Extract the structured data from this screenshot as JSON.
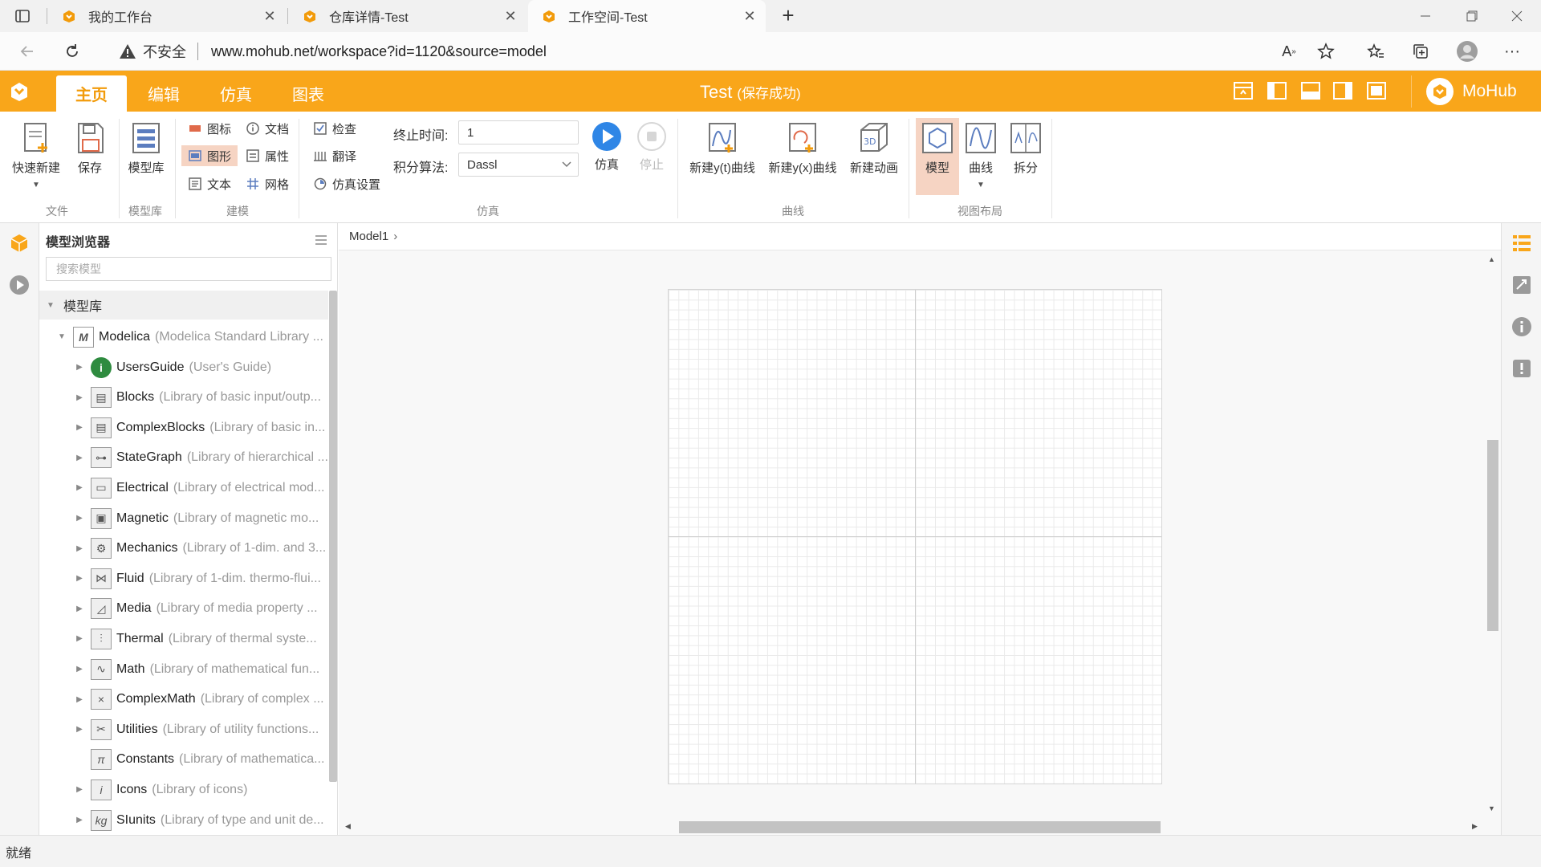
{
  "browser": {
    "tabs": [
      {
        "title": "我的工作台",
        "active": false
      },
      {
        "title": "仓库详情-Test",
        "active": false
      },
      {
        "title": "工作空间-Test",
        "active": true
      }
    ],
    "new_tab": "+",
    "url_warning": "不安全",
    "url": "www.mohub.net/workspace?id=1120&source=model"
  },
  "app": {
    "menu_tabs": [
      "主页",
      "编辑",
      "仿真",
      "图表"
    ],
    "active_tab": "主页",
    "doc_title": "Test",
    "doc_status": "(保存成功)",
    "brand": "MoHub",
    "accent": "#f9a61a"
  },
  "ribbon": {
    "quick_new": "快速新建",
    "save": "保存",
    "model_lib": "模型库",
    "icon_view": "图标",
    "doc_view": "文档",
    "diagram_view": "图形",
    "props_view": "属性",
    "text_view": "文本",
    "grid_view": "网格",
    "check": "检查",
    "translate": "翻译",
    "sim_settings": "仿真设置",
    "stop_time_label": "终止时间:",
    "stop_time_value": "1",
    "algorithm_label": "积分算法:",
    "algorithm_value": "Dassl",
    "simulate": "仿真",
    "stop": "停止",
    "new_yt": "新建y(t)曲线",
    "new_yx": "新建y(x)曲线",
    "new_anim": "新建动画",
    "layout_model": "模型",
    "layout_curve": "曲线",
    "layout_split": "拆分",
    "groups": {
      "file": "文件",
      "lib": "模型库",
      "modeling": "建模",
      "simulation": "仿真",
      "curve": "曲线",
      "view_layout": "视图布局"
    }
  },
  "browser_panel": {
    "title": "模型浏览器",
    "search_placeholder": "搜索模型",
    "lib_header": "模型库",
    "root": {
      "name": "Modelica",
      "desc": "(Modelica Standard Library ..."
    },
    "items": [
      {
        "name": "UsersGuide",
        "desc": "(User's Guide)",
        "icon": "info-icon"
      },
      {
        "name": "Blocks",
        "desc": "(Library of basic input/outp...",
        "icon": "blocks-icon"
      },
      {
        "name": "ComplexBlocks",
        "desc": "(Library of basic in...",
        "icon": "complex-blocks-icon"
      },
      {
        "name": "StateGraph",
        "desc": "(Library of hierarchical ...",
        "icon": "stategraph-icon"
      },
      {
        "name": "Electrical",
        "desc": "(Library of electrical mod...",
        "icon": "electrical-icon"
      },
      {
        "name": "Magnetic",
        "desc": "(Library of magnetic mo...",
        "icon": "magnetic-icon"
      },
      {
        "name": "Mechanics",
        "desc": "(Library of 1-dim. and 3...",
        "icon": "mechanics-icon"
      },
      {
        "name": "Fluid",
        "desc": "(Library of 1-dim. thermo-flui...",
        "icon": "fluid-icon"
      },
      {
        "name": "Media",
        "desc": "(Library of media property ...",
        "icon": "media-icon"
      },
      {
        "name": "Thermal",
        "desc": "(Library of thermal syste...",
        "icon": "thermal-icon"
      },
      {
        "name": "Math",
        "desc": "(Library of mathematical fun...",
        "icon": "math-icon"
      },
      {
        "name": "ComplexMath",
        "desc": "(Library of complex ...",
        "icon": "complex-math-icon"
      },
      {
        "name": "Utilities",
        "desc": "(Library of utility functions...",
        "icon": "utilities-icon"
      },
      {
        "name": "Constants",
        "desc": "(Library of mathematica...",
        "icon": "constants-icon"
      },
      {
        "name": "Icons",
        "desc": "(Library of icons)",
        "icon": "icons-icon"
      },
      {
        "name": "SIunits",
        "desc": "(Library of type and unit de...",
        "icon": "siunits-icon"
      }
    ]
  },
  "canvas": {
    "breadcrumb": "Model1"
  },
  "status": "就绪"
}
